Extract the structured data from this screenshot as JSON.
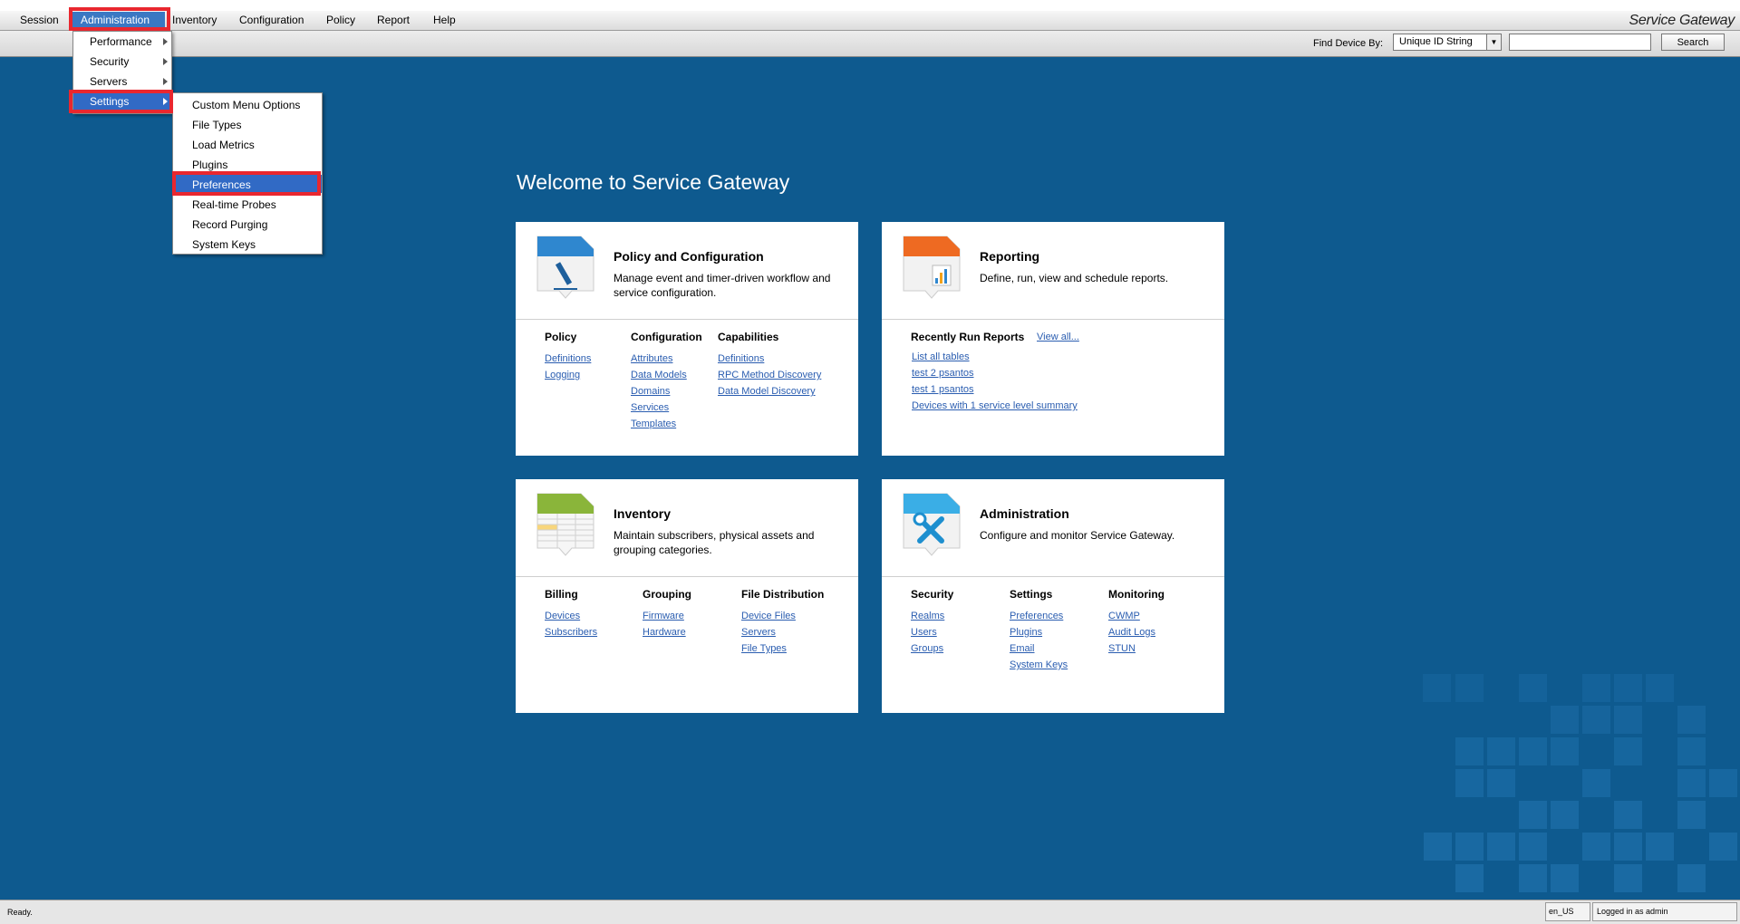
{
  "app": {
    "brand": "Service Gateway",
    "menu": [
      "Session",
      "Administration",
      "Inventory",
      "Configuration",
      "Policy",
      "Report",
      "Help"
    ]
  },
  "toolbar": {
    "find_label": "Find Device By:",
    "find_select_value": "Unique ID String",
    "search_value": "",
    "search_label": "Search"
  },
  "admin_menu": [
    "Performance",
    "Security",
    "Servers",
    "Settings"
  ],
  "settings_menu": [
    "Custom Menu Options",
    "File Types",
    "Load Metrics",
    "Plugins",
    "Preferences",
    "Real-time Probes",
    "Record Purging",
    "System Keys"
  ],
  "main": {
    "welcome": "Welcome to Service Gateway",
    "cards": {
      "policy": {
        "title": "Policy and Configuration",
        "desc": "Manage event and timer-driven workflow and service configuration.",
        "columns": [
          {
            "header": "Policy",
            "links": [
              "Definitions",
              "Logging"
            ]
          },
          {
            "header": "Configuration",
            "links": [
              "Attributes",
              "Data Models",
              "Domains",
              "Services",
              "Templates"
            ]
          },
          {
            "header": "Capabilities",
            "links": [
              "Definitions",
              "RPC Method Discovery",
              "Data Model Discovery"
            ]
          }
        ]
      },
      "reporting": {
        "title": "Reporting",
        "desc": "Define, run, view and schedule reports.",
        "recent_header": "Recently Run Reports",
        "view_all": "View all...",
        "recent": [
          "List all tables",
          "test 2 psantos",
          "test 1 psantos",
          "Devices with 1 service level summary"
        ]
      },
      "inventory": {
        "title": "Inventory",
        "desc": "Maintain subscribers, physical assets and grouping categories.",
        "columns": [
          {
            "header": "Billing",
            "links": [
              "Devices",
              "Subscribers"
            ]
          },
          {
            "header": "Grouping",
            "links": [
              "Firmware",
              "Hardware"
            ]
          },
          {
            "header": "File Distribution",
            "links": [
              "Device Files",
              "Servers",
              "File Types"
            ]
          }
        ]
      },
      "administration": {
        "title": "Administration",
        "desc": "Configure and monitor Service Gateway.",
        "columns": [
          {
            "header": "Security",
            "links": [
              "Realms",
              "Users",
              "Groups"
            ]
          },
          {
            "header": "Settings",
            "links": [
              "Preferences",
              "Plugins",
              "Email",
              "System Keys"
            ]
          },
          {
            "header": "Monitoring",
            "links": [
              "CWMP",
              "Audit Logs",
              "STUN"
            ]
          }
        ]
      }
    }
  },
  "status": {
    "text": "Ready.",
    "locale": "en_US",
    "login": "Logged in as admin"
  }
}
